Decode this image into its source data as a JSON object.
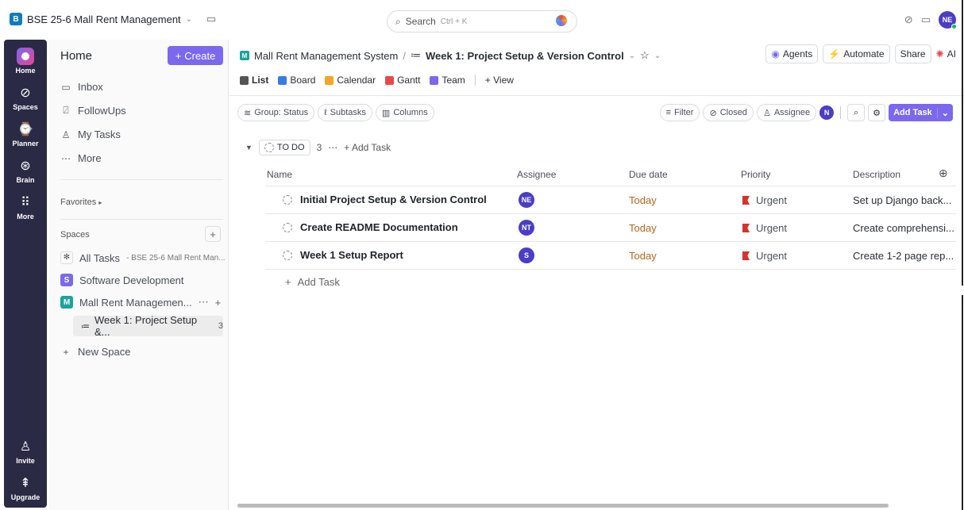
{
  "topbar": {
    "workspace_badge": "B",
    "workspace_name": "BSE 25-6 Mall Rent Management",
    "search_placeholder": "Search",
    "search_hint": "Ctrl + K",
    "user_initials": "NE"
  },
  "rail": {
    "items": [
      {
        "label": "Home",
        "icon": "home-icon"
      },
      {
        "label": "Spaces",
        "icon": "spaces-icon"
      },
      {
        "label": "Planner",
        "icon": "planner-icon"
      },
      {
        "label": "Brain",
        "icon": "brain-icon"
      },
      {
        "label": "More",
        "icon": "grid-icon"
      }
    ],
    "bottom": [
      {
        "label": "Invite",
        "icon": "invite-icon"
      },
      {
        "label": "Upgrade",
        "icon": "upgrade-icon"
      }
    ]
  },
  "sidebar": {
    "title": "Home",
    "create_label": "Create",
    "nav": [
      {
        "label": "Inbox",
        "icon": "inbox-icon"
      },
      {
        "label": "FollowUps",
        "icon": "followups-icon"
      },
      {
        "label": "My Tasks",
        "icon": "my-tasks-icon"
      },
      {
        "label": "More",
        "icon": "ellipsis-icon"
      }
    ],
    "favorites_label": "Favorites",
    "spaces_label": "Spaces",
    "all_tasks_label": "All Tasks",
    "all_tasks_sub": "- BSE 25-6 Mall Rent Man...",
    "spaces": [
      {
        "badge": "S",
        "label": "Software Development",
        "color": "#7b68ee"
      },
      {
        "badge": "M",
        "label": "Mall Rent Managemen...",
        "color": "#1ba39c"
      }
    ],
    "active_list_label": "Week 1: Project Setup &...",
    "active_list_count": "3",
    "new_space_label": "New Space"
  },
  "main": {
    "breadcrumb_space": "Mall Rent Management System",
    "breadcrumb_list": "Week 1: Project Setup & Version Control",
    "agents_label": "Agents",
    "automate_label": "Automate",
    "share_label": "Share",
    "ai_label": "AI",
    "views": [
      {
        "label": "List",
        "color": "#555"
      },
      {
        "label": "Board",
        "color": "#3a7be0"
      },
      {
        "label": "Calendar",
        "color": "#f5a623"
      },
      {
        "label": "Gantt",
        "color": "#e8484a"
      },
      {
        "label": "Team",
        "color": "#7b68ee"
      }
    ],
    "add_view_label": "View",
    "toolbar": {
      "group_label": "Group: Status",
      "subtasks_label": "Subtasks",
      "columns_label": "Columns",
      "filter_label": "Filter",
      "closed_label": "Closed",
      "assignee_label": "Assignee",
      "me_initial": "N",
      "add_task_label": "Add Task"
    },
    "group": {
      "status": "TO DO",
      "count": "3",
      "add_task_label": "Add Task"
    },
    "columns": [
      "Name",
      "Assignee",
      "Due date",
      "Priority",
      "Description"
    ],
    "tasks": [
      {
        "name": "Initial Project Setup & Version Control",
        "assignee": "NE",
        "due": "Today",
        "priority": "Urgent",
        "description": "Set up Django back..."
      },
      {
        "name": "Create README Documentation",
        "assignee": "NT",
        "due": "Today",
        "priority": "Urgent",
        "description": "Create comprehensi..."
      },
      {
        "name": "Week 1 Setup Report",
        "assignee": "S",
        "due": "Today",
        "priority": "Urgent",
        "description": "Create 1-2 page rep..."
      }
    ],
    "add_task_row_label": "Add Task"
  }
}
